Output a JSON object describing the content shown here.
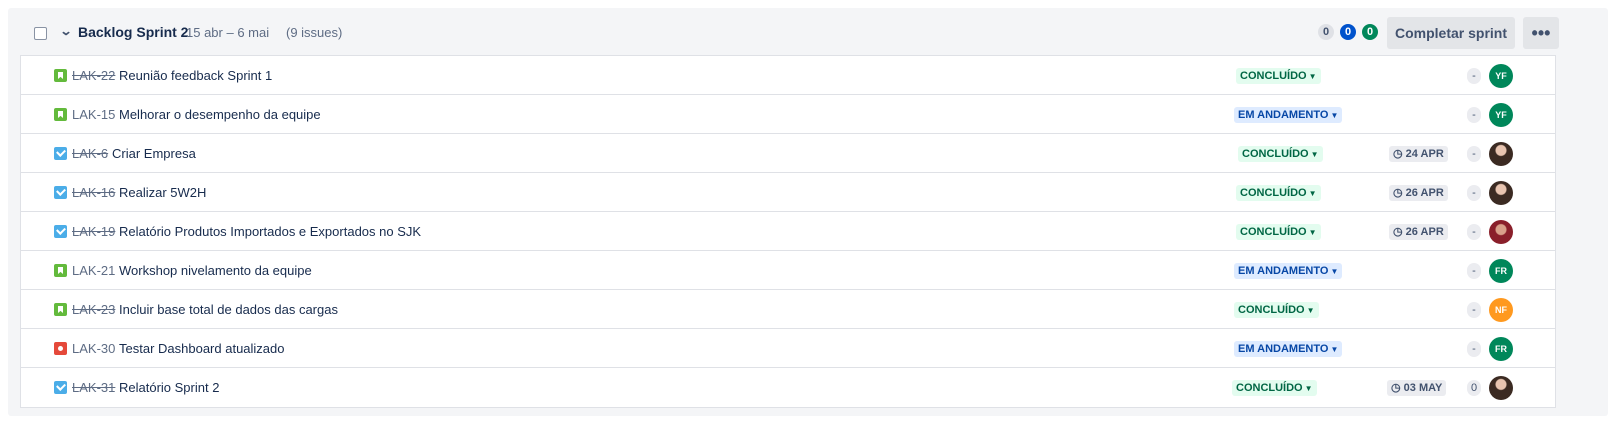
{
  "sprint": {
    "name": "Backlog Sprint 2",
    "dates": "15 abr – 6 mai",
    "issue_count": "(9 issues)",
    "counts": {
      "todo": "0",
      "in_progress": "0",
      "done": "0"
    },
    "complete_label": "Completar sprint",
    "more_label": "•••"
  },
  "issues": [
    {
      "key": "LAK-22",
      "summary": "Reunião feedback Sprint 1",
      "type": "story",
      "key_struck": true,
      "status": "CONCLUÍDO",
      "due": "",
      "estimate": "-",
      "assignee": "YF",
      "avatar": "green"
    },
    {
      "key": "LAK-15",
      "summary": "Melhorar o desempenho da equipe",
      "type": "story",
      "key_struck": false,
      "status": "EM ANDAMENTO",
      "due": "",
      "estimate": "-",
      "assignee": "YF",
      "avatar": "green"
    },
    {
      "key": "LAK-6",
      "summary": "Criar Empresa",
      "type": "task",
      "key_struck": true,
      "status": "CONCLUÍDO",
      "due": "24 APR",
      "estimate": "-",
      "assignee": "",
      "avatar": "photo"
    },
    {
      "key": "LAK-16",
      "summary": "Realizar 5W2H",
      "type": "task",
      "key_struck": true,
      "status": "CONCLUÍDO",
      "due": "26 APR",
      "estimate": "-",
      "assignee": "",
      "avatar": "photo"
    },
    {
      "key": "LAK-19",
      "summary": "Relatório Produtos Importados e Exportados no SJK",
      "type": "task",
      "key_struck": true,
      "status": "CONCLUÍDO",
      "due": "26 APR",
      "estimate": "-",
      "assignee": "",
      "avatar": "photo2"
    },
    {
      "key": "LAK-21",
      "summary": "Workshop nivelamento da equipe",
      "type": "story",
      "key_struck": false,
      "status": "EM ANDAMENTO",
      "due": "",
      "estimate": "-",
      "assignee": "FR",
      "avatar": "green"
    },
    {
      "key": "LAK-23",
      "summary": "Incluir base total de dados das cargas",
      "type": "story",
      "key_struck": true,
      "status": "CONCLUÍDO",
      "due": "",
      "estimate": "-",
      "assignee": "NF",
      "avatar": "orange"
    },
    {
      "key": "LAK-30",
      "summary": "Testar Dashboard atualizado",
      "type": "bug",
      "key_struck": false,
      "status": "EM ANDAMENTO",
      "due": "",
      "estimate": "-",
      "assignee": "FR",
      "avatar": "green"
    },
    {
      "key": "LAK-31",
      "summary": "Relatório Sprint 2",
      "type": "task",
      "key_struck": true,
      "status": "CONCLUÍDO",
      "due": "03 MAY",
      "estimate": "0",
      "assignee": "",
      "avatar": "photo"
    }
  ]
}
